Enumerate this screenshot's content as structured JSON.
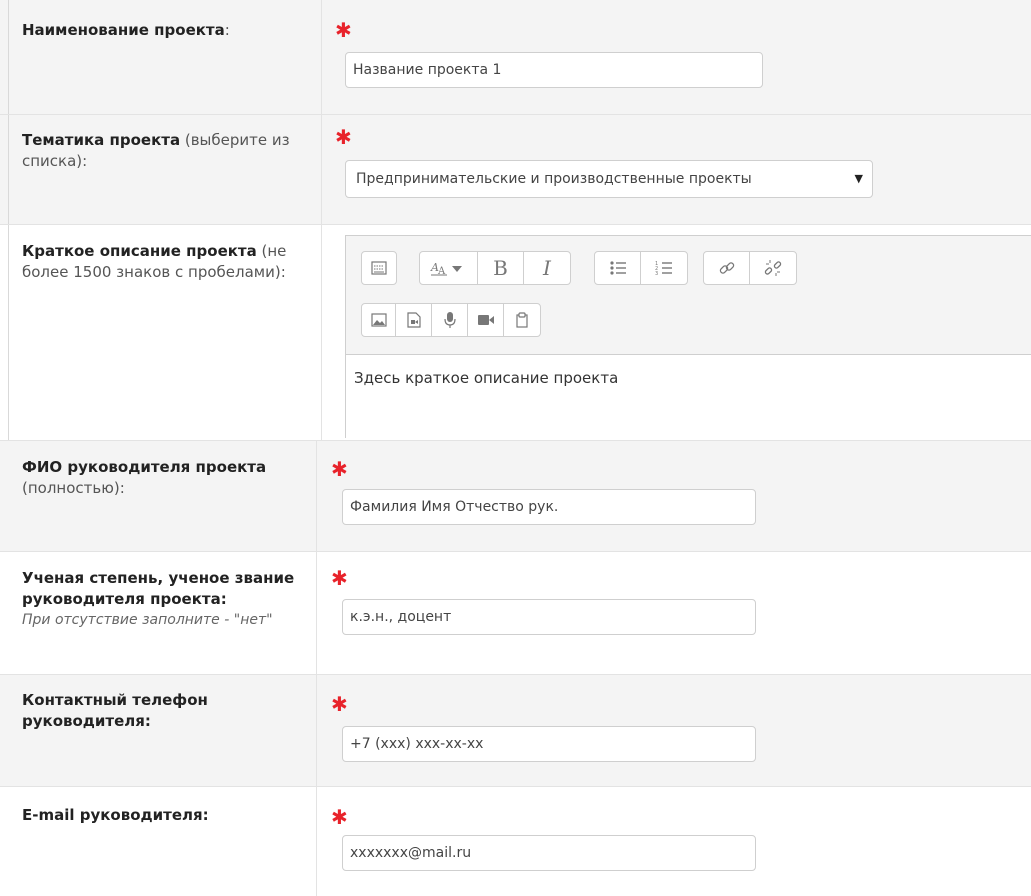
{
  "rows": {
    "project_name": {
      "label_bold": "Наименование проекта",
      "label_rest": ":",
      "value": "Название проекта 1"
    },
    "project_topic": {
      "label_bold": "Тематика проекта",
      "label_rest": " (выберите из списка):",
      "selected": "Предпринимательские и производственные проекты",
      "arrow": "▼"
    },
    "project_description": {
      "label_bold": "Краткое описание проекта",
      "label_rest": " (не более 1500 знаков с пробелами):",
      "content": "Здесь краткое описание проекта"
    },
    "manager_name": {
      "label_bold": "ФИО руководителя проекта",
      "label_rest": " (полностью):",
      "value": "Фамилия Имя Отчество рук."
    },
    "manager_degree": {
      "label_bold": "Ученая степень, ученое звание руководителя проекта:",
      "note": "При отсутствие заполните - \"нет\"",
      "value": "к.э.н., доцент"
    },
    "manager_phone": {
      "label_bold": "Контактный телефон руководителя:",
      "value": "+7 (xxx) xxx-xx-xx"
    },
    "manager_email": {
      "label_bold": "E-mail руководителя:",
      "value": "xxxxxxx@mail.ru"
    }
  },
  "required_mark": "✱",
  "toolbar_buttons": {
    "show_more": "more-buttons-icon",
    "font_style": "font-style-icon",
    "bold": "B",
    "italic": "I",
    "unordered_list": "unordered-list-icon",
    "ordered_list": "ordered-list-icon",
    "link": "link-icon",
    "unlink": "unlink-icon",
    "image": "image-icon",
    "media": "media-icon",
    "record_audio": "microphone-icon",
    "record_video": "video-icon",
    "manage_files": "files-icon"
  },
  "colors": {
    "required": "#e8222a",
    "row_alt": "#f4f4f4",
    "border": "#cfcfcf"
  }
}
